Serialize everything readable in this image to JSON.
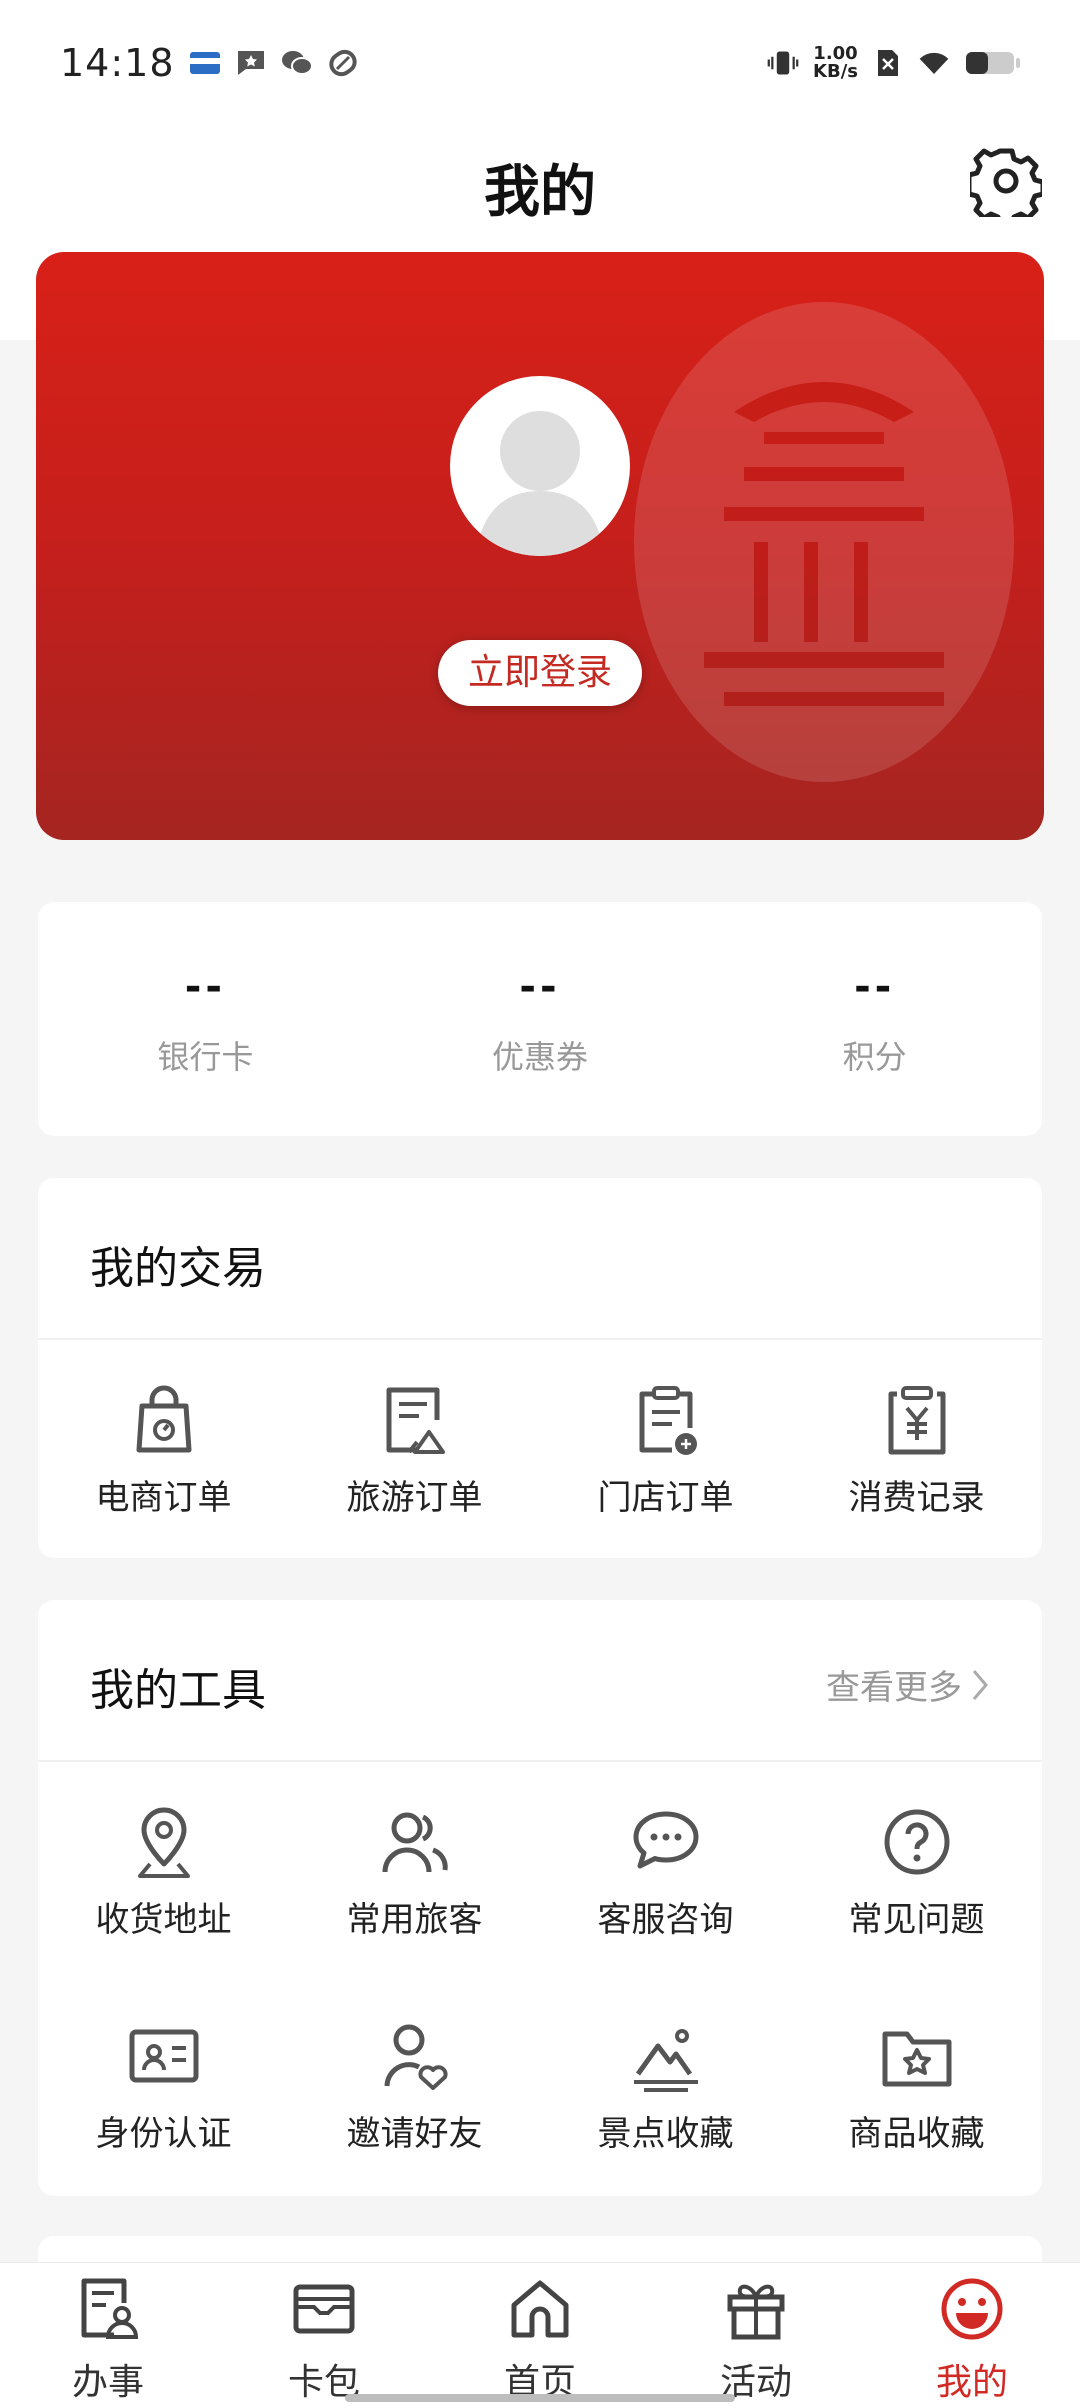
{
  "status_bar": {
    "time": "14:18",
    "speed_value": "1.00",
    "speed_unit": "KB/s"
  },
  "header": {
    "title": "我的"
  },
  "profile": {
    "login_label": "立即登录"
  },
  "stats": [
    {
      "value": "--",
      "label": "银行卡"
    },
    {
      "value": "--",
      "label": "优惠券"
    },
    {
      "value": "--",
      "label": "积分"
    }
  ],
  "transactions": {
    "title": "我的交易",
    "items": [
      {
        "label": "电商订单",
        "icon": "shopping-bag-icon"
      },
      {
        "label": "旅游订单",
        "icon": "travel-document-icon"
      },
      {
        "label": "门店订单",
        "icon": "clipboard-store-icon"
      },
      {
        "label": "消费记录",
        "icon": "yuan-clipboard-icon"
      }
    ]
  },
  "tools": {
    "title": "我的工具",
    "more_label": "查看更多",
    "items": [
      {
        "label": "收货地址",
        "icon": "location-pin-icon"
      },
      {
        "label": "常用旅客",
        "icon": "users-icon"
      },
      {
        "label": "客服咨询",
        "icon": "chat-bubbles-icon"
      },
      {
        "label": "常见问题",
        "icon": "question-circle-icon"
      },
      {
        "label": "身份认证",
        "icon": "id-card-icon"
      },
      {
        "label": "邀请好友",
        "icon": "user-heart-icon"
      },
      {
        "label": "景点收藏",
        "icon": "mountain-icon"
      },
      {
        "label": "商品收藏",
        "icon": "folder-star-icon"
      }
    ]
  },
  "tabbar": {
    "items": [
      {
        "label": "办事",
        "icon": "document-person-icon"
      },
      {
        "label": "卡包",
        "icon": "wallet-icon"
      },
      {
        "label": "首页",
        "icon": "home-icon"
      },
      {
        "label": "活动",
        "icon": "gift-icon"
      },
      {
        "label": "我的",
        "icon": "smiley-icon"
      }
    ],
    "active_index": 4
  },
  "colors": {
    "brand_red": "#d12a25",
    "card_gradient_top": "#d82018",
    "card_gradient_bottom": "#a52521"
  }
}
